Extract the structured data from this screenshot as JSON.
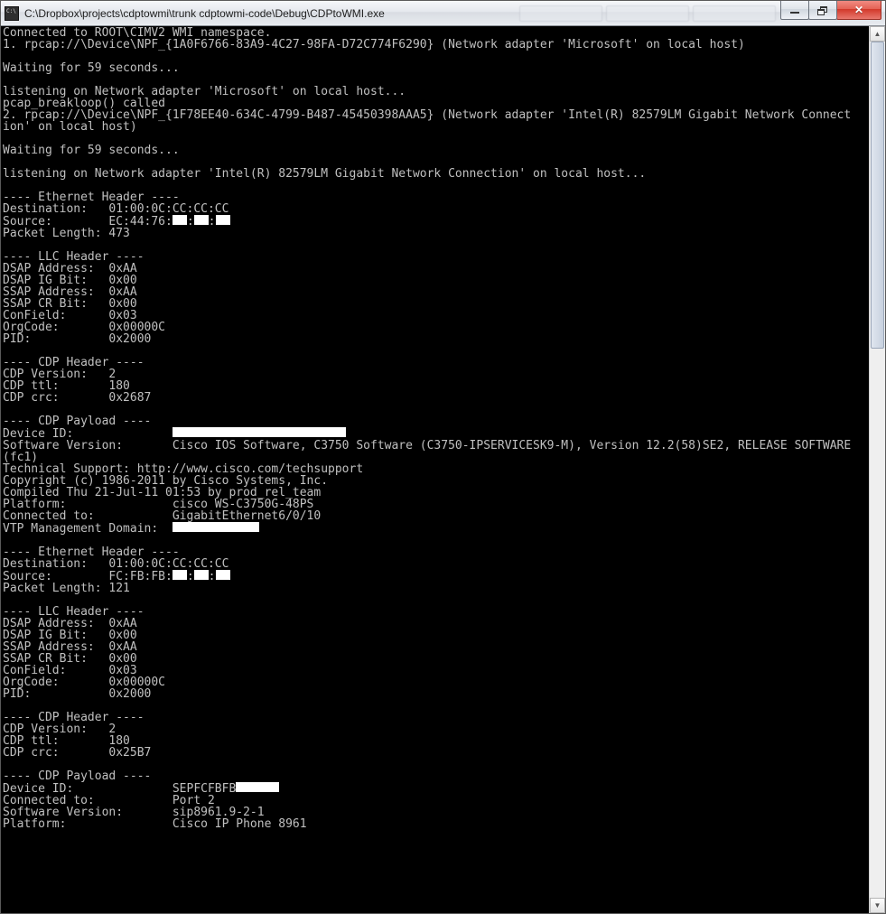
{
  "window": {
    "title": "C:\\Dropbox\\projects\\cdptowmi\\trunk cdptowmi-code\\Debug\\CDPtoWMI.exe"
  },
  "console": {
    "lines": [
      "Connected to ROOT\\CIMV2 WMI namespace.",
      "1. rpcap://\\Device\\NPF_{1A0F6766-83A9-4C27-98FA-D72C774F6290} (Network adapter 'Microsoft' on local host)",
      "",
      "Waiting for 59 seconds...",
      "",
      "listening on Network adapter 'Microsoft' on local host...",
      "pcap_breakloop() called",
      "2. rpcap://\\Device\\NPF_{1F78EE40-634C-4799-B487-45450398AAA5} (Network adapter 'Intel(R) 82579LM Gigabit Network Connect",
      "ion' on local host)",
      "",
      "Waiting for 59 seconds...",
      "",
      "listening on Network adapter 'Intel(R) 82579LM Gigabit Network Connection' on local host...",
      "",
      "---- Ethernet Header ----",
      "Destination:   01:00:0C:CC:CC:CC",
      "Source:        EC:44:76:██:██:██",
      "Packet Length: 473",
      "",
      "---- LLC Header ----",
      "DSAP Address:  0xAA",
      "DSAP IG Bit:   0x00",
      "SSAP Address:  0xAA",
      "SSAP CR Bit:   0x00",
      "ConField:      0x03",
      "OrgCode:       0x00000C",
      "PID:           0x2000",
      "",
      "---- CDP Header ----",
      "CDP Version:   2",
      "CDP ttl:       180",
      "CDP crc:       0x2687",
      "",
      "---- CDP Payload ----",
      "Device ID:              ████████████████████████",
      "Software Version:       Cisco IOS Software, C3750 Software (C3750-IPSERVICESK9-M), Version 12.2(58)SE2, RELEASE SOFTWARE",
      "(fc1)",
      "Technical Support: http://www.cisco.com/techsupport",
      "Copyright (c) 1986-2011 by Cisco Systems, Inc.",
      "Compiled Thu 21-Jul-11 01:53 by prod_rel_team",
      "Platform:               cisco WS-C3750G-48PS",
      "Connected to:           GigabitEthernet6/0/10",
      "VTP Management Domain:  ████████████",
      "",
      "---- Ethernet Header ----",
      "Destination:   01:00:0C:CC:CC:CC",
      "Source:        FC:FB:FB:██:██:██",
      "Packet Length: 121",
      "",
      "---- LLC Header ----",
      "DSAP Address:  0xAA",
      "DSAP IG Bit:   0x00",
      "SSAP Address:  0xAA",
      "SSAP CR Bit:   0x00",
      "ConField:      0x03",
      "OrgCode:       0x00000C",
      "PID:           0x2000",
      "",
      "---- CDP Header ----",
      "CDP Version:   2",
      "CDP ttl:       180",
      "CDP crc:       0x25B7",
      "",
      "---- CDP Payload ----",
      "Device ID:              SEPFCFBFB██████",
      "Connected to:           Port 2",
      "Software Version:       sip8961.9-2-1",
      "Platform:               Cisco IP Phone 8961"
    ]
  }
}
